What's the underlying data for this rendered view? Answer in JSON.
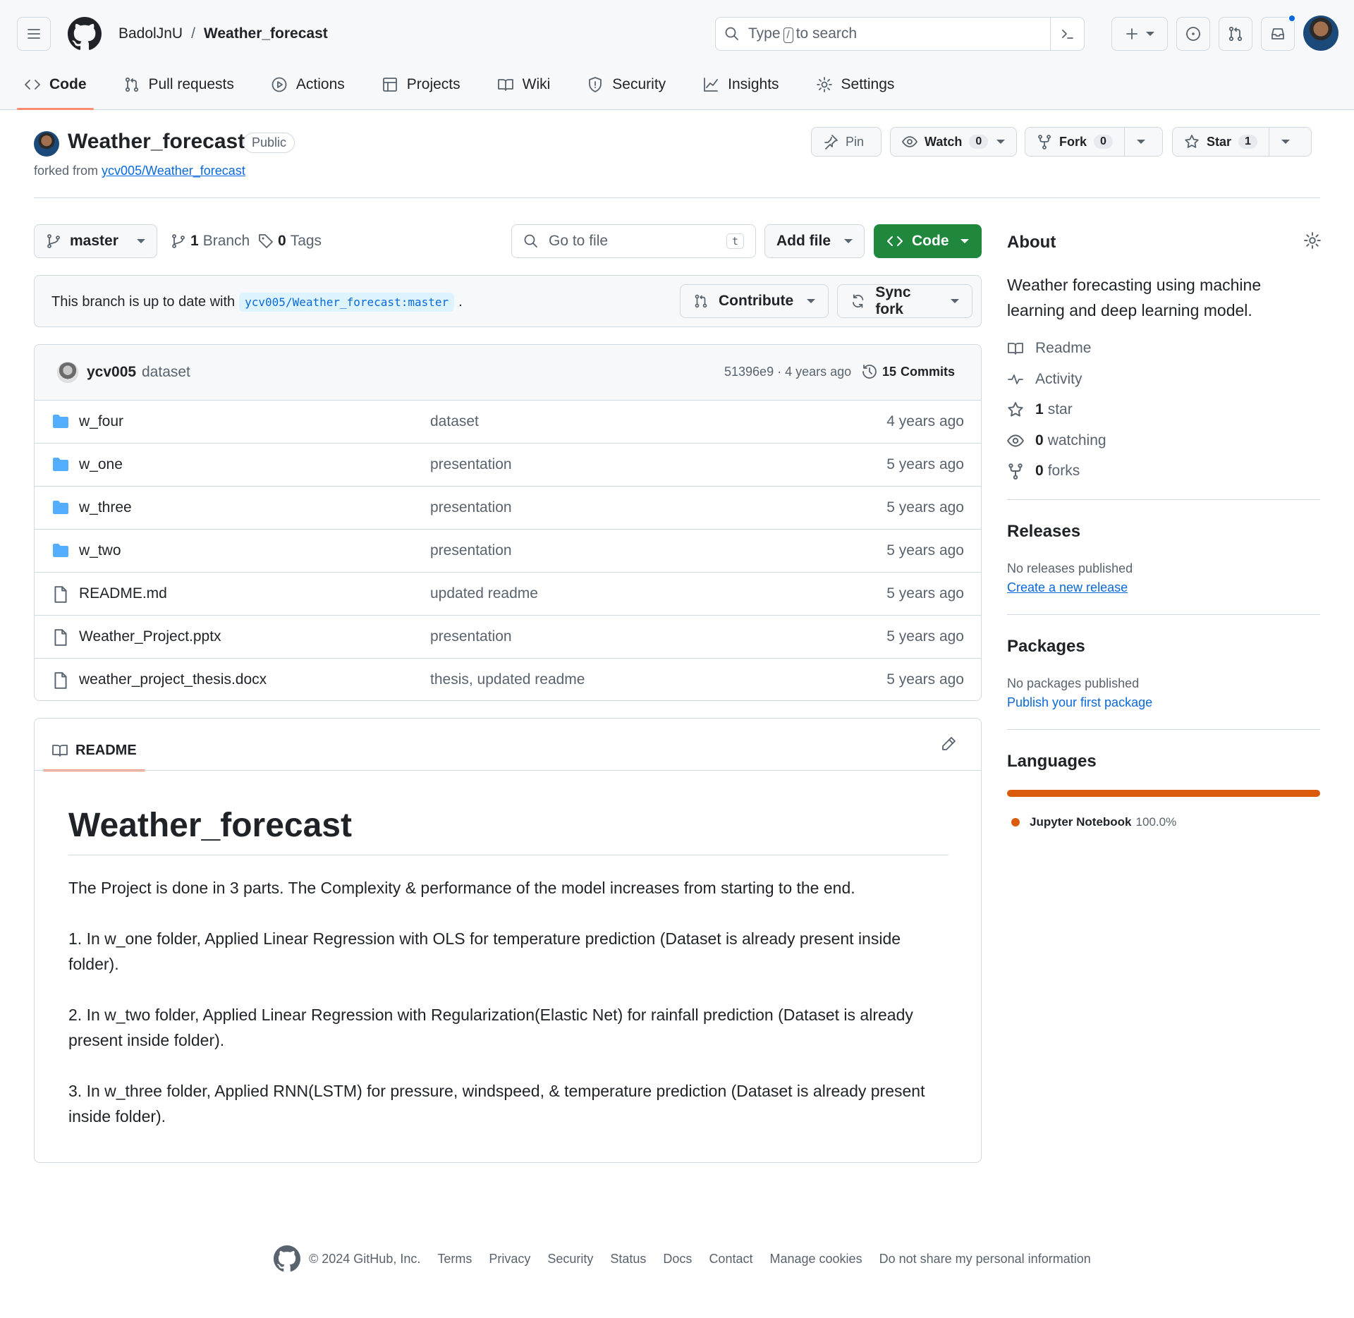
{
  "header": {
    "owner": "BadolJnU",
    "separator": "/",
    "repo": "Weather_forecast",
    "search_prefix": "Type",
    "search_key": "/",
    "search_suffix": "to search"
  },
  "nav": {
    "tabs": [
      {
        "label": "Code",
        "icon": "code-icon"
      },
      {
        "label": "Pull requests",
        "icon": "git-pull-request-icon"
      },
      {
        "label": "Actions",
        "icon": "play-icon"
      },
      {
        "label": "Projects",
        "icon": "table-icon"
      },
      {
        "label": "Wiki",
        "icon": "book-icon"
      },
      {
        "label": "Security",
        "icon": "shield-icon"
      },
      {
        "label": "Insights",
        "icon": "graph-icon"
      },
      {
        "label": "Settings",
        "icon": "gear-icon"
      }
    ]
  },
  "repo_header": {
    "title": "Weather_forecast",
    "visibility": "Public",
    "forked_from_label": "forked from",
    "forked_from_link": "ycv005/Weather_forecast",
    "pin_label": "Pin",
    "watch_label": "Watch",
    "watch_count": "0",
    "fork_label": "Fork",
    "fork_count": "0",
    "star_label": "Star",
    "star_count": "1"
  },
  "controls": {
    "branch": "master",
    "branches_count": "1",
    "branches_label": "Branch",
    "tags_count": "0",
    "tags_label": "Tags",
    "goto_placeholder": "Go to file",
    "goto_key": "t",
    "add_file_label": "Add file",
    "code_label": "Code"
  },
  "branch_status": {
    "text": "This branch is up to date with",
    "ref": "ycv005/Weather_forecast:master",
    "period": ".",
    "contribute_label": "Contribute",
    "sync_label": "Sync fork"
  },
  "latest_commit": {
    "author": "ycv005",
    "message": "dataset",
    "sha_age": "51396e9 · 4 years ago",
    "commits_count": "15",
    "commits_label": "Commits"
  },
  "files": [
    {
      "type": "folder",
      "name": "w_four",
      "message": "dataset",
      "age": "4 years ago"
    },
    {
      "type": "folder",
      "name": "w_one",
      "message": "presentation",
      "age": "5 years ago"
    },
    {
      "type": "folder",
      "name": "w_three",
      "message": "presentation",
      "age": "5 years ago"
    },
    {
      "type": "folder",
      "name": "w_two",
      "message": "presentation",
      "age": "5 years ago"
    },
    {
      "type": "file",
      "name": "README.md",
      "message": "updated readme",
      "age": "5 years ago"
    },
    {
      "type": "file",
      "name": "Weather_Project.pptx",
      "message": "presentation",
      "age": "5 years ago"
    },
    {
      "type": "file",
      "name": "weather_project_thesis.docx",
      "message": "thesis, updated readme",
      "age": "5 years ago"
    }
  ],
  "readme": {
    "tab_label": "README",
    "title": "Weather_forecast",
    "paragraphs": [
      "The Project is done in 3 parts. The Complexity & performance of the model increases from starting to the end.",
      "1. In w_one folder, Applied Linear Regression with OLS for temperature prediction (Dataset is already present inside folder).",
      "2. In w_two folder, Applied Linear Regression with Regularization(Elastic Net) for rainfall prediction (Dataset is already present inside folder).",
      "3. In w_three folder, Applied RNN(LSTM) for pressure, windspeed, & temperature prediction (Dataset is already present inside folder)."
    ]
  },
  "about": {
    "title": "About",
    "description": "Weather forecasting using machine learning and deep learning model.",
    "readme_label": "Readme",
    "activity_label": "Activity",
    "stars_count": "1",
    "stars_label": "star",
    "watching_count": "0",
    "watching_label": "watching",
    "forks_count": "0",
    "forks_label": "forks"
  },
  "releases": {
    "title": "Releases",
    "empty": "No releases published",
    "link": "Create a new release"
  },
  "packages": {
    "title": "Packages",
    "empty": "No packages published",
    "link": "Publish your first package"
  },
  "languages": {
    "title": "Languages",
    "items": [
      {
        "name": "Jupyter Notebook",
        "percent": "100.0%",
        "color": "#da5b0b"
      }
    ]
  },
  "footer": {
    "copyright": "© 2024 GitHub, Inc.",
    "links": [
      "Terms",
      "Privacy",
      "Security",
      "Status",
      "Docs",
      "Contact",
      "Manage cookies",
      "Do not share my personal information"
    ]
  },
  "colors": {
    "accent": "#0969da",
    "primary_button": "#1f883d",
    "tab_underline": "#fd8c73",
    "folder": "#54aeff"
  }
}
